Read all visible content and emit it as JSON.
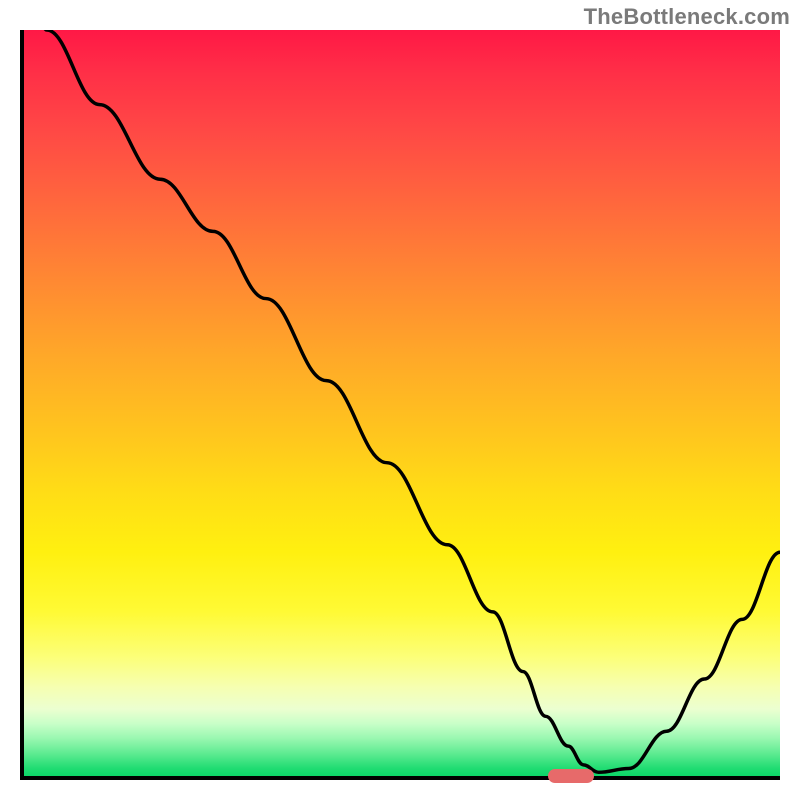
{
  "watermark": "TheBottleneck.com",
  "colors": {
    "gradient_top": "#ff1846",
    "gradient_mid": "#ffd219",
    "gradient_bottom": "#0cd768",
    "axis": "#000000",
    "curve": "#000000",
    "marker": "#e76a6a",
    "watermark_text": "#7a7a7a"
  },
  "chart_data": {
    "type": "line",
    "title": "",
    "xlabel": "",
    "ylabel": "",
    "xlim": [
      0,
      100
    ],
    "ylim": [
      0,
      100
    ],
    "x": [
      0,
      3,
      10,
      18,
      25,
      32,
      40,
      48,
      56,
      62,
      66,
      69,
      72,
      74,
      76,
      80,
      85,
      90,
      95,
      100
    ],
    "values": [
      110,
      100,
      90,
      80,
      73,
      64,
      53,
      42,
      31,
      22,
      14,
      8,
      4,
      1.5,
      0.5,
      1,
      6,
      13,
      21,
      30
    ],
    "marker": {
      "x_start": 69,
      "x_end": 75,
      "y": 0
    },
    "note": "y is height above baseline as percent of plot height; values are estimated from the image"
  }
}
